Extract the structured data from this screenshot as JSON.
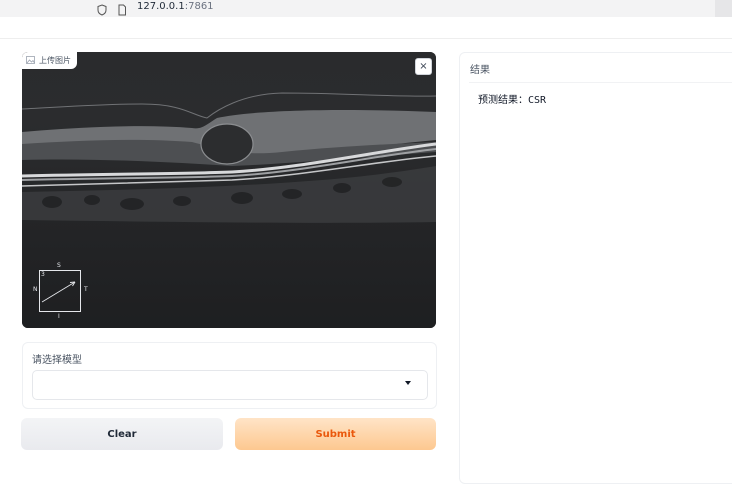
{
  "browser": {
    "url_host": "127.0.0.1",
    "url_port": ":7861"
  },
  "image_input": {
    "label": "上传图片",
    "close_symbol": "×",
    "orientation": {
      "top": "S",
      "bottom": "I",
      "left": "N",
      "right": "T",
      "corner": "3"
    }
  },
  "model_select": {
    "label": "请选择模型",
    "value": ""
  },
  "buttons": {
    "clear": "Clear",
    "submit": "Submit"
  },
  "result": {
    "label": "结果",
    "text": "预测结果：CSR"
  },
  "icons": [
    "shield-icon",
    "page-icon",
    "image-icon",
    "close-icon",
    "dropdown-caret-icon"
  ]
}
